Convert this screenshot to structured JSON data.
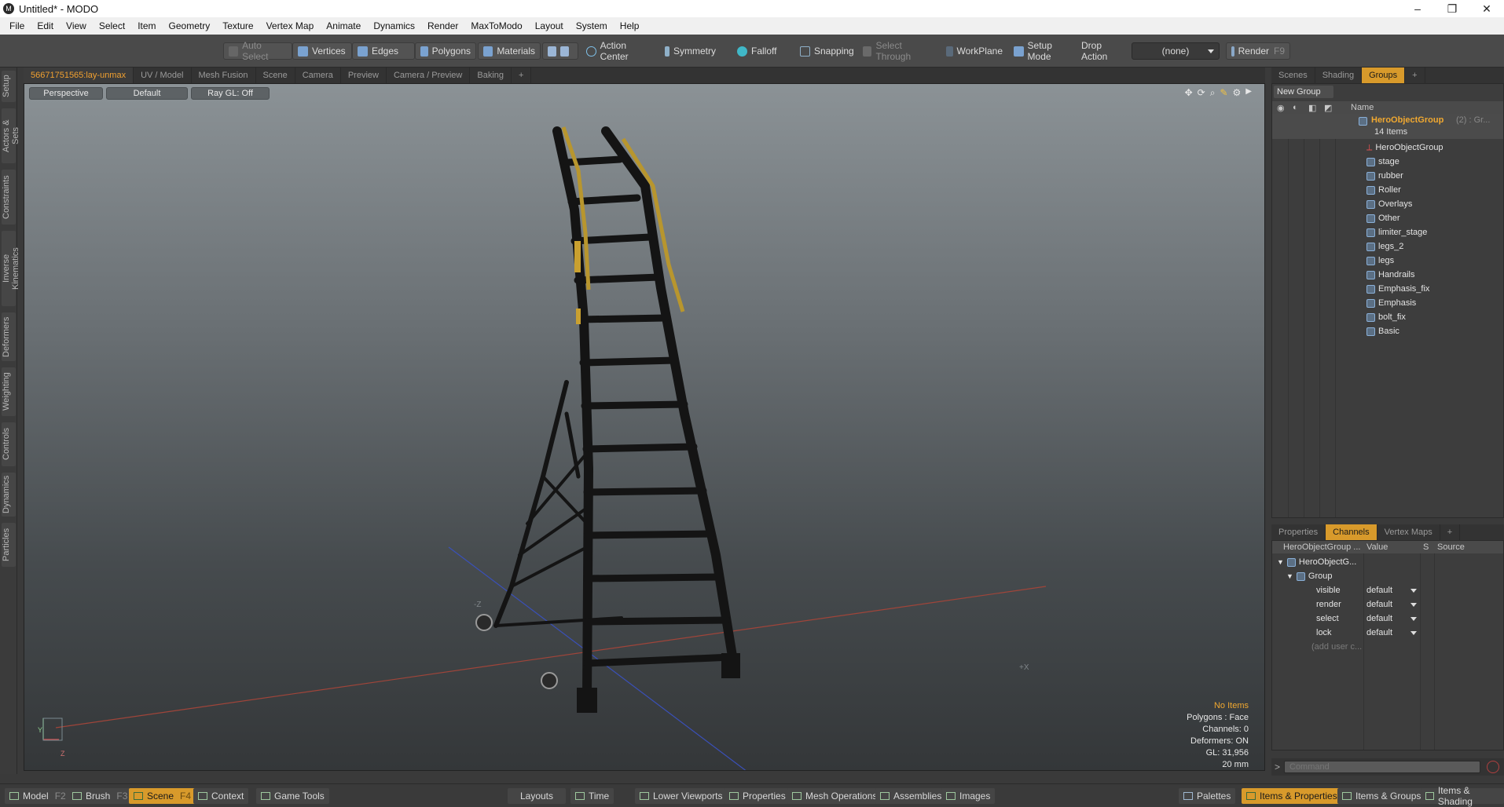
{
  "window": {
    "title": "Untitled* - MODO",
    "logo": "M",
    "min": "–",
    "restore": "❐",
    "close": "✕"
  },
  "menu": [
    "File",
    "Edit",
    "View",
    "Select",
    "Item",
    "Geometry",
    "Texture",
    "Vertex Map",
    "Animate",
    "Dynamics",
    "Render",
    "MaxToModo",
    "Layout",
    "System",
    "Help"
  ],
  "toolbar": {
    "auto_select": "Auto Select",
    "vertices": "Vertices",
    "edges": "Edges",
    "polygons": "Polygons",
    "materials": "Materials",
    "action_center": "Action Center",
    "symmetry": "Symmetry",
    "falloff": "Falloff",
    "snapping": "Snapping",
    "select_through": "Select Through",
    "workplane": "WorkPlane",
    "setup_mode": "Setup Mode",
    "drop_action": "Drop Action",
    "drop_action_value": "(none)",
    "render": "Render",
    "render_key": "F9"
  },
  "viewport_tabs": [
    "56671751565:lay-unmax",
    "UV / Model",
    "Mesh Fusion",
    "Scene",
    "Camera",
    "Preview",
    "Camera / Preview",
    "Baking",
    "+"
  ],
  "left_tabs": [
    "Setup",
    "Actors & Sets",
    "Constraints",
    "Inverse Kinematics",
    "Deformers",
    "Weighting",
    "Controls",
    "Dynamics",
    "Particles"
  ],
  "viewport": {
    "perspective": "Perspective",
    "shading": "Default",
    "raygl": "Ray GL: Off",
    "info": {
      "items": "No Items",
      "polygons": "Polygons : Face",
      "channels": "Channels: 0",
      "deformers": "Deformers: ON",
      "gl": "GL: 31,956",
      "scale": "20 mm"
    },
    "axis_y": "Y",
    "axis_z": "Z",
    "label_minus_z": "-Z",
    "label_plus_x": "+X"
  },
  "groups_panel": {
    "tabs": [
      "Scenes",
      "Shading",
      "Groups",
      "+"
    ],
    "new_group": "New Group",
    "name_header": "Name",
    "root": {
      "name": "HeroObjectGroup",
      "suffix": "(2) : Gr...",
      "count": "14 Items"
    },
    "items": [
      "HeroObjectGroup",
      "stage",
      "rubber",
      "Roller",
      "Overlays",
      "Other",
      "limiter_stage",
      "legs_2",
      "legs",
      "Handrails",
      "Emphasis_fix",
      "Emphasis",
      "bolt_fix",
      "Basic"
    ]
  },
  "channels_panel": {
    "tabs": [
      "Properties",
      "Channels",
      "Vertex Maps",
      "+"
    ],
    "headers": {
      "name": "HeroObjectGroup ...",
      "value": "Value",
      "s": "S",
      "source": "Source"
    },
    "root": "HeroObjectG...",
    "group": "Group",
    "rows": [
      {
        "name": "visible",
        "value": "default"
      },
      {
        "name": "render",
        "value": "default"
      },
      {
        "name": "select",
        "value": "default"
      },
      {
        "name": "lock",
        "value": "default"
      }
    ],
    "add_user": "(add user c..."
  },
  "command": {
    "placeholder": "Command",
    "prompt": ">"
  },
  "bottom": {
    "model": "Model",
    "model_key": "F2",
    "brush": "Brush",
    "brush_key": "F3",
    "scene": "Scene",
    "scene_key": "F4",
    "context": "Context",
    "game_tools": "Game Tools",
    "layouts": "Layouts",
    "time": "Time",
    "lower_viewports": "Lower Viewports",
    "properties": "Properties",
    "mesh_operations": "Mesh Operations",
    "assemblies": "Assemblies",
    "images": "Images",
    "palettes": "Palettes",
    "items_properties": "Items & Properties",
    "items_groups": "Items & Groups",
    "items_shading": "Items & Shading"
  },
  "colors": {
    "accent": "#d89a2b",
    "ladder_frame": "#161616",
    "ladder_rail": "#b8962e"
  }
}
